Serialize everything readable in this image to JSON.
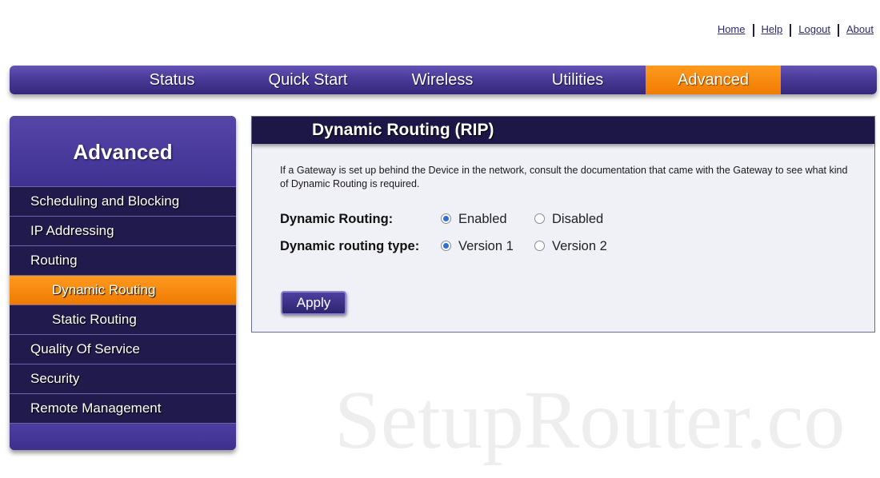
{
  "top_links": [
    "Home",
    "Help",
    "Logout",
    "About"
  ],
  "nav": {
    "tabs": [
      {
        "label": "Status",
        "active": false
      },
      {
        "label": "Quick Start",
        "active": false
      },
      {
        "label": "Wireless",
        "active": false
      },
      {
        "label": "Utilities",
        "active": false
      },
      {
        "label": "Advanced",
        "active": true
      }
    ]
  },
  "sidebar": {
    "title": "Advanced",
    "items": [
      {
        "label": "Scheduling and Blocking",
        "sub": false,
        "active": false
      },
      {
        "label": "IP Addressing",
        "sub": false,
        "active": false
      },
      {
        "label": "Routing",
        "sub": false,
        "active": false
      },
      {
        "label": "Dynamic Routing",
        "sub": true,
        "active": true
      },
      {
        "label": "Static Routing",
        "sub": true,
        "active": false
      },
      {
        "label": "Quality Of Service",
        "sub": false,
        "active": false
      },
      {
        "label": "Security",
        "sub": false,
        "active": false
      },
      {
        "label": "Remote Management",
        "sub": false,
        "active": false
      }
    ]
  },
  "panel": {
    "title": "Dynamic Routing (RIP)",
    "description": "If a Gateway is set up behind the Device in the network, consult the documentation that came with the Gateway to see what kind of Dynamic Routing is required.",
    "dynamic_routing": {
      "label": "Dynamic Routing:",
      "options": [
        "Enabled",
        "Disabled"
      ],
      "selected": "Enabled"
    },
    "routing_type": {
      "label": "Dynamic routing type:",
      "options": [
        "Version 1",
        "Version 2"
      ],
      "selected": "Version 1"
    },
    "apply_label": "Apply"
  },
  "watermark": "SetupRouter.co",
  "colors": {
    "nav_purple": "#4a3a99",
    "active_orange": "#f07c00",
    "sidebar_dark": "#211a4c",
    "panel_header": "#1c1747",
    "radio_selected": "#2f6fd0"
  }
}
